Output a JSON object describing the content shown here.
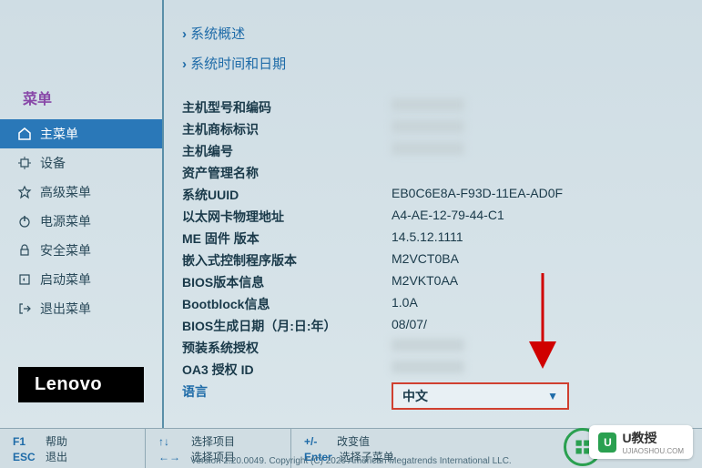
{
  "sidebar": {
    "title": "菜单",
    "items": [
      {
        "label": "主菜单"
      },
      {
        "label": "设备"
      },
      {
        "label": "高级菜单"
      },
      {
        "label": "电源菜单"
      },
      {
        "label": "安全菜单"
      },
      {
        "label": "启动菜单"
      },
      {
        "label": "退出菜单"
      }
    ]
  },
  "logo": "Lenovo",
  "nav": {
    "overview": "系统概述",
    "datetime": "系统时间和日期"
  },
  "info": {
    "model_label": "主机型号和编码",
    "brand_label": "主机商标标识",
    "serial_label": "主机编号",
    "asset_label": "资产管理名称",
    "uuid_label": "系统UUID",
    "uuid_value": "EB0C6E8A-F93D-11EA-AD0F",
    "mac_label": "以太网卡物理地址",
    "mac_value": "A4-AE-12-79-44-C1",
    "me_label": "ME 固件 版本",
    "me_value": "14.5.12.1111",
    "ec_label": "嵌入式控制程序版本",
    "ec_value": "M2VCT0BA",
    "bios_label": "BIOS版本信息",
    "bios_value": "M2VKT0AA",
    "bootblock_label": "Bootblock信息",
    "bootblock_value": "1.0A",
    "bios_date_label": "BIOS生成日期（月:日:年）",
    "bios_date_value": "08/07/",
    "preload_label": "预装系统授权",
    "oa3_label": "OA3 授权 ID",
    "lang_label": "语言",
    "lang_value": "中文"
  },
  "footer": {
    "f1_key": "F1",
    "f1_label": "帮助",
    "esc_key": "ESC",
    "esc_label": "退出",
    "arrows1_key": "↑↓",
    "arrows1_label": "选择项目",
    "arrows2_key": "←→",
    "arrows2_label": "选择项目",
    "change_key": "+/-",
    "change_label": "改变值",
    "enter_key": "Enter",
    "enter_label": "选择子菜单"
  },
  "copyright": "Version 2.20.0049. Copyright (C) 2020 American Megatrends International LLC.",
  "watermark": {
    "brand": "U教授",
    "url": "UJIAOSHOU.COM"
  }
}
